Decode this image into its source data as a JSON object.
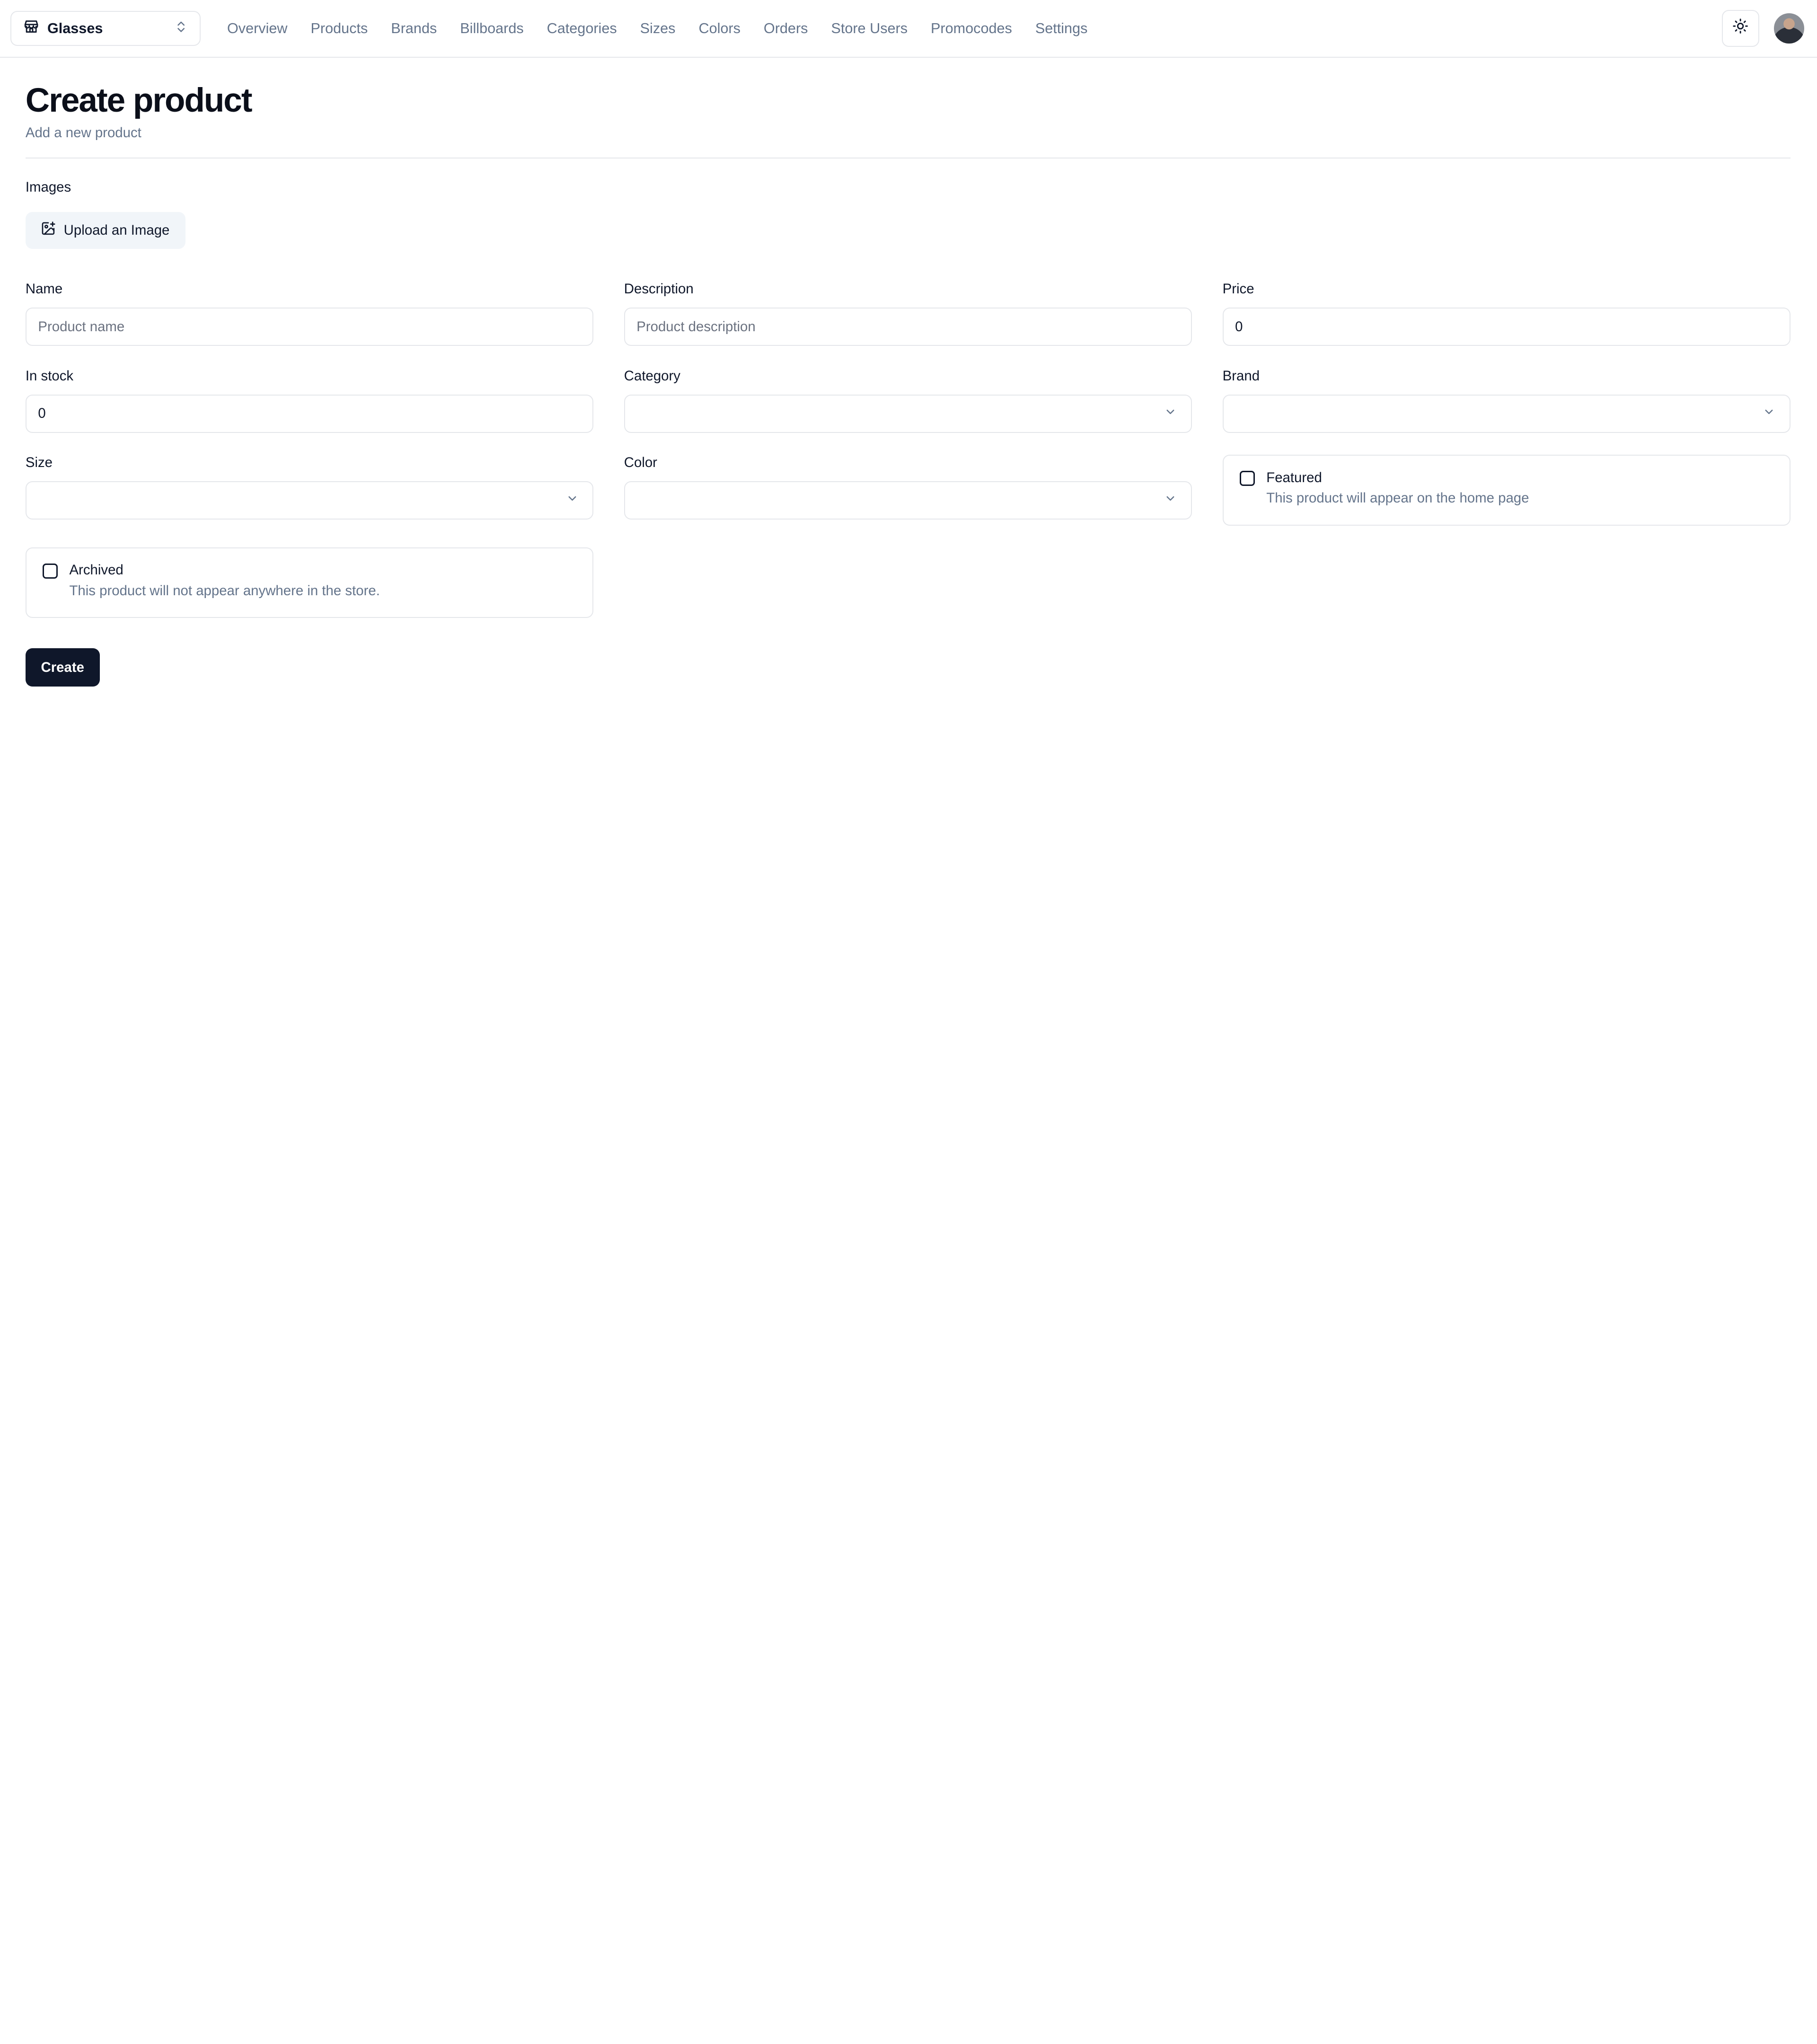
{
  "store_switcher": {
    "name": "Glasses"
  },
  "nav": {
    "items": [
      "Overview",
      "Products",
      "Brands",
      "Billboards",
      "Categories",
      "Sizes",
      "Colors",
      "Orders",
      "Store Users",
      "Promocodes",
      "Settings"
    ]
  },
  "header": {
    "title": "Create product",
    "subtitle": "Add a new product"
  },
  "images": {
    "label": "Images",
    "upload_label": "Upload an Image"
  },
  "form": {
    "name": {
      "label": "Name",
      "placeholder": "Product name"
    },
    "description": {
      "label": "Description",
      "placeholder": "Product description"
    },
    "price": {
      "label": "Price",
      "value": "0"
    },
    "in_stock": {
      "label": "In stock",
      "value": "0"
    },
    "category": {
      "label": "Category",
      "value": ""
    },
    "brand": {
      "label": "Brand",
      "value": ""
    },
    "size": {
      "label": "Size",
      "value": ""
    },
    "color": {
      "label": "Color",
      "value": ""
    },
    "featured": {
      "label": "Featured",
      "description": "This product will appear on the home page",
      "checked": false
    },
    "archived": {
      "label": "Archived",
      "description": "This product will not appear anywhere in the store.",
      "checked": false
    },
    "submit_label": "Create"
  },
  "colors": {
    "primary": "#0f172a",
    "muted": "#64748b",
    "border": "#e5e7eb",
    "secondary_bg": "#f1f5f9"
  }
}
